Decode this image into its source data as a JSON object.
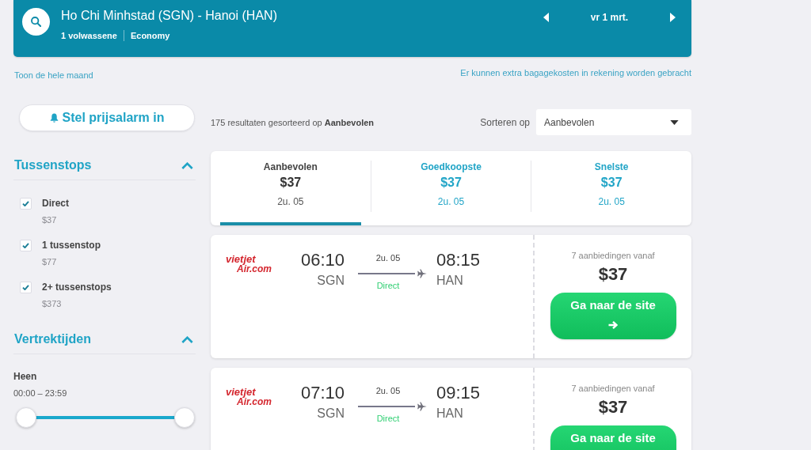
{
  "search_bar": {
    "route": "Ho Chi Minhstad (SGN) - Hanoi (HAN)",
    "passengers": "1 volwassene",
    "cabin_class": "Economy",
    "date": "vr 1 mrt."
  },
  "month_link": "Toon de hele maand",
  "baggage_note": "Er kunnen extra bagagekosten in rekening worden gebracht",
  "price_alert_button": "Stel prijsalarm in",
  "results_summary": "175 resultaten gesorteerd op **Aanbevolen**",
  "sort": {
    "label": "Sorteren op",
    "value": "Aanbevolen"
  },
  "filters": [
    {
      "kind": "checkboxes",
      "title": "Tussenstops",
      "expanded": true,
      "options": [
        {
          "label": "Direct",
          "price": "$37",
          "checked": true
        },
        {
          "label": "1 tussenstop",
          "price": "$77",
          "checked": true
        },
        {
          "label": "2+ tussenstops",
          "price": "$373",
          "checked": true
        }
      ]
    },
    {
      "kind": "time_range",
      "title": "Vertrektijden",
      "expanded": true,
      "label": "Heen",
      "range": "00:00 – 23:59",
      "thumbs": [
        {
          "level": 0
        },
        {
          "level": 1
        }
      ]
    }
  ],
  "sort_tabs": [
    {
      "label": "Aanbevolen",
      "price": "$37",
      "duration": "2u. 05",
      "selected": true
    },
    {
      "label": "Goedkoopste",
      "price": "$37",
      "duration": "2u. 05",
      "selected": false
    },
    {
      "label": "Snelste",
      "price": "$37",
      "duration": "2u. 05",
      "selected": false
    }
  ],
  "results": [
    {
      "airline_logo": [
        "vietjet",
        "Air.com"
      ],
      "departure_time": "06:10",
      "departure_airport": "SGN",
      "duration": "2u. 05",
      "stops": "Direct",
      "arrival_time": "08:15",
      "arrival_airport": "HAN",
      "offers": "7 aanbiedingen vanaf",
      "price": "$37",
      "button": "Ga naar de site"
    },
    {
      "airline_logo": [
        "vietjet",
        "Air.com"
      ],
      "departure_time": "07:10",
      "departure_airport": "SGN",
      "duration": "2u. 05",
      "stops": "Direct",
      "arrival_time": "09:15",
      "arrival_airport": "HAN",
      "offers": "7 aanbiedingen vanaf",
      "price": "$37",
      "button": "Ga naar de site"
    }
  ]
}
